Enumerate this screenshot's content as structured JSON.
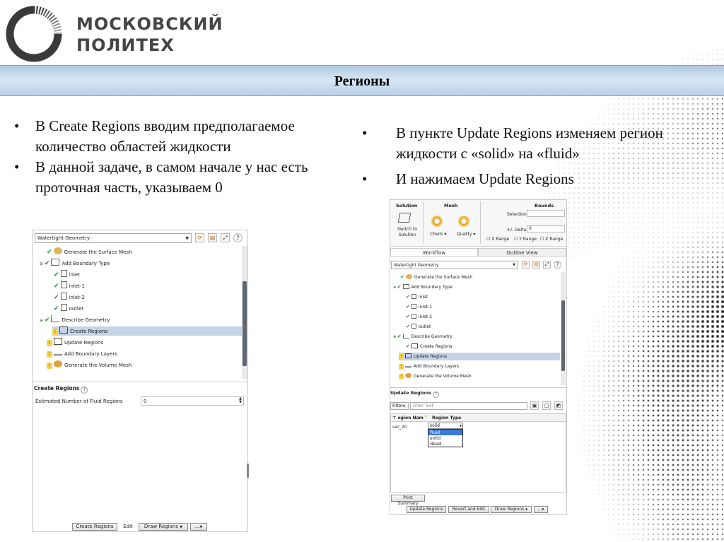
{
  "brand": {
    "line1": "МОСКОВСКИЙ",
    "line2": "ПОЛИТЕХ"
  },
  "slide_title": "Регионы",
  "left_bullets": [
    "В Create Regions вводим предполагаемое количество областей жидкости",
    "В данной задаче, в самом начале у нас есть проточная часть, указываем 0"
  ],
  "right_bullets": [
    "В пункте Update Regions изменяем регион жидкости с «solid» на «fluid»",
    "И нажимаем Update Regions"
  ],
  "panel1": {
    "workflow": "Watertight Geometry",
    "tree": [
      "Generate the Surface Mesh",
      "Add Boundary Type",
      "inlet",
      "inlet-1",
      "inlet-2",
      "outlet",
      "Describe Geometry",
      "Create Regions",
      "Update Regions",
      "Add Boundary Layers",
      "Generate the Volume Mesh"
    ],
    "section": "Create Regions",
    "field_label": "Estimated Number of Fluid Regions",
    "field_value": "0",
    "btn_create": "Create Regions",
    "btn_edit": "Edit",
    "btn_draw": "Draw Regions",
    "btn_more": "..."
  },
  "panel2": {
    "ribbon": {
      "solution": "Solution",
      "switch": "Switch to Solution",
      "mesh": "Mesh",
      "check": "Check",
      "quality": "Quality",
      "bounds": "Bounds",
      "selection": "Selection",
      "delta_label": "+/- Delta",
      "delta_value": "0",
      "x_range": "X Range",
      "y_range": "Y Range",
      "z_range": "Z Range"
    },
    "tabs": [
      "Workflow",
      "Outline View"
    ],
    "workflow": "Watertight Geometry",
    "tree": [
      "Generate the Surface Mesh",
      "Add Boundary Type",
      "inlet",
      "inlet-1",
      "inlet-2",
      "outlet",
      "Describe Geometry",
      "Create Regions",
      "Update Regions",
      "Add Boundary Layers",
      "Generate the Volume Mesh"
    ],
    "section": "Update Regions",
    "filter": "Filter",
    "filter_placeholder": "Filter Text",
    "col_name": "egion Nam",
    "col_type": "Region Type",
    "row_name": "var_20",
    "row_type": "solid",
    "options": [
      "fluid",
      "solid",
      "dead"
    ],
    "print": "Print Summary",
    "btn_update": "Update Regions",
    "btn_revert": "Revert and Edit",
    "btn_draw": "Draw Regions",
    "btn_more": "..."
  }
}
